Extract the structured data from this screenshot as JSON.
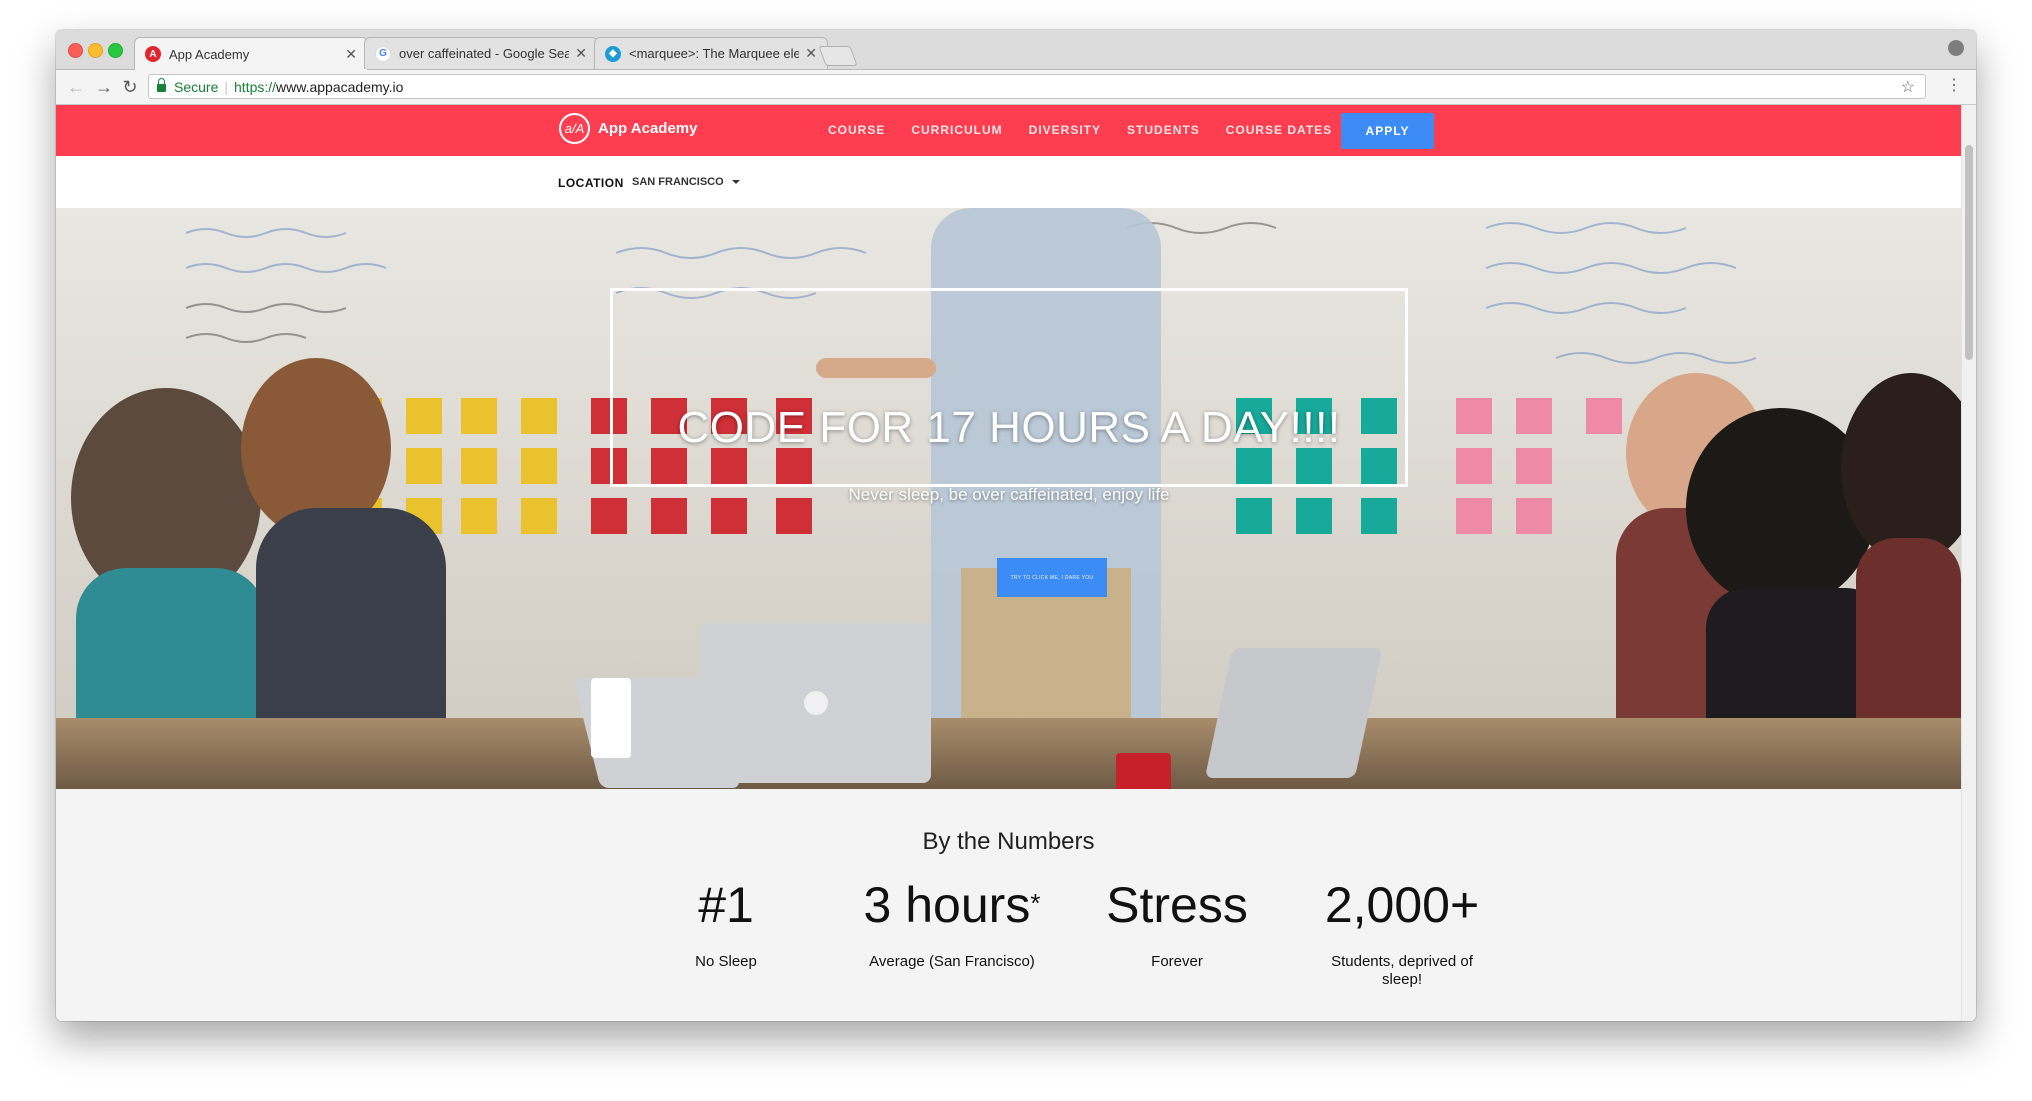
{
  "browser": {
    "tabs": [
      {
        "title": "App Academy",
        "favicon_color": "#e3252d",
        "favicon_glyph": "A",
        "active": true
      },
      {
        "title": "over caffeinated - Google Sear",
        "favicon_color": "#4285f4",
        "favicon_glyph": "G",
        "active": false
      },
      {
        "title": "<marquee>: The Marquee elem",
        "favicon_color": "#1b9cd6",
        "favicon_glyph": "◆",
        "active": false
      }
    ],
    "address": {
      "secure_label": "Secure",
      "scheme": "https://",
      "host": "www.appacademy.io"
    }
  },
  "site_nav": {
    "logo_mark": "a/A",
    "logo_text": "App Academy",
    "links": [
      "COURSE",
      "CURRICULUM",
      "DIVERSITY",
      "STUDENTS",
      "COURSE DATES"
    ],
    "apply_label": "APPLY",
    "brand_color": "#fe3e50",
    "button_color": "#3d8cf5"
  },
  "location": {
    "label": "LOCATION",
    "value": "SAN FRANCISCO"
  },
  "hero": {
    "title": "CODE FOR 17 HOURS A DAY!!!!",
    "subtitle": "Never sleep, be over caffeinated, enjoy life",
    "cta_label": "TRY TO CLICK ME, I DARE YOU"
  },
  "numbers": {
    "title": "By the Numbers",
    "stats": [
      {
        "value": "#1",
        "sup": "",
        "label": "No Sleep"
      },
      {
        "value": "3 hours",
        "sup": "*",
        "label": "Average (San Francisco)"
      },
      {
        "value": "Stress",
        "sup": "",
        "label": "Forever"
      },
      {
        "value": "2,000+",
        "sup": "",
        "label": "Students, deprived of sleep!"
      }
    ]
  }
}
